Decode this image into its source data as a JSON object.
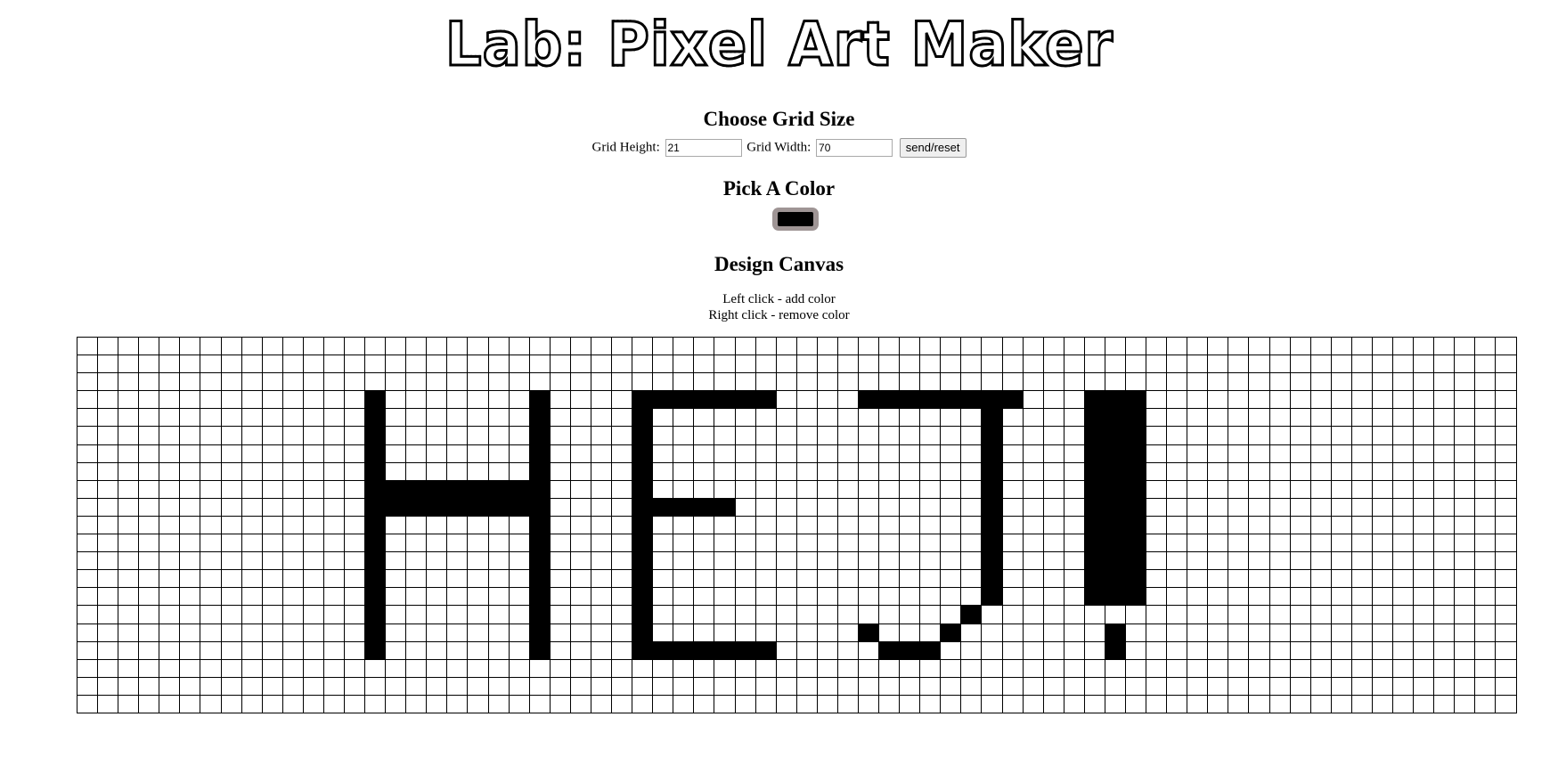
{
  "header": {
    "title": "Lab: Pixel Art Maker"
  },
  "grid_size": {
    "heading": "Choose Grid Size",
    "height_label": "Grid Height:",
    "height_value": "21",
    "width_label": "Grid Width:",
    "width_value": "70",
    "submit_label": "send/reset"
  },
  "color": {
    "heading": "Pick A Color",
    "value": "#000000",
    "ring_color": "#9f9595"
  },
  "canvas": {
    "heading": "Design Canvas",
    "instruction_left": "Left click - add color",
    "instruction_right": "Right click - remove color",
    "rows": 21,
    "cols": 70,
    "filled_color": "#000000",
    "grid_line_color": "#000000",
    "filled_runs": [
      [
        3,
        14,
        14
      ],
      [
        3,
        22,
        22
      ],
      [
        3,
        27,
        33
      ],
      [
        3,
        38,
        45
      ],
      [
        3,
        49,
        51
      ],
      [
        4,
        14,
        14
      ],
      [
        4,
        22,
        22
      ],
      [
        4,
        27,
        27
      ],
      [
        4,
        44,
        44
      ],
      [
        4,
        49,
        51
      ],
      [
        5,
        14,
        14
      ],
      [
        5,
        22,
        22
      ],
      [
        5,
        27,
        27
      ],
      [
        5,
        44,
        44
      ],
      [
        5,
        49,
        51
      ],
      [
        6,
        14,
        14
      ],
      [
        6,
        22,
        22
      ],
      [
        6,
        27,
        27
      ],
      [
        6,
        44,
        44
      ],
      [
        6,
        49,
        51
      ],
      [
        7,
        14,
        14
      ],
      [
        7,
        22,
        22
      ],
      [
        7,
        27,
        27
      ],
      [
        7,
        44,
        44
      ],
      [
        7,
        49,
        51
      ],
      [
        8,
        14,
        22
      ],
      [
        8,
        27,
        27
      ],
      [
        8,
        44,
        44
      ],
      [
        8,
        49,
        51
      ],
      [
        9,
        14,
        22
      ],
      [
        9,
        27,
        31
      ],
      [
        9,
        44,
        44
      ],
      [
        9,
        49,
        51
      ],
      [
        10,
        14,
        14
      ],
      [
        10,
        22,
        22
      ],
      [
        10,
        27,
        27
      ],
      [
        10,
        44,
        44
      ],
      [
        10,
        49,
        51
      ],
      [
        11,
        14,
        14
      ],
      [
        11,
        22,
        22
      ],
      [
        11,
        27,
        27
      ],
      [
        11,
        44,
        44
      ],
      [
        11,
        49,
        51
      ],
      [
        12,
        14,
        14
      ],
      [
        12,
        22,
        22
      ],
      [
        12,
        27,
        27
      ],
      [
        12,
        44,
        44
      ],
      [
        12,
        49,
        51
      ],
      [
        13,
        14,
        14
      ],
      [
        13,
        22,
        22
      ],
      [
        13,
        27,
        27
      ],
      [
        13,
        44,
        44
      ],
      [
        13,
        49,
        51
      ],
      [
        14,
        14,
        14
      ],
      [
        14,
        22,
        22
      ],
      [
        14,
        27,
        27
      ],
      [
        14,
        44,
        44
      ],
      [
        14,
        49,
        51
      ],
      [
        15,
        14,
        14
      ],
      [
        15,
        22,
        22
      ],
      [
        15,
        27,
        27
      ],
      [
        15,
        43,
        43
      ],
      [
        16,
        14,
        14
      ],
      [
        16,
        22,
        22
      ],
      [
        16,
        27,
        27
      ],
      [
        16,
        38,
        38
      ],
      [
        16,
        42,
        42
      ],
      [
        16,
        50,
        50
      ],
      [
        17,
        14,
        14
      ],
      [
        17,
        22,
        22
      ],
      [
        17,
        27,
        33
      ],
      [
        17,
        39,
        41
      ],
      [
        17,
        50,
        50
      ]
    ]
  }
}
